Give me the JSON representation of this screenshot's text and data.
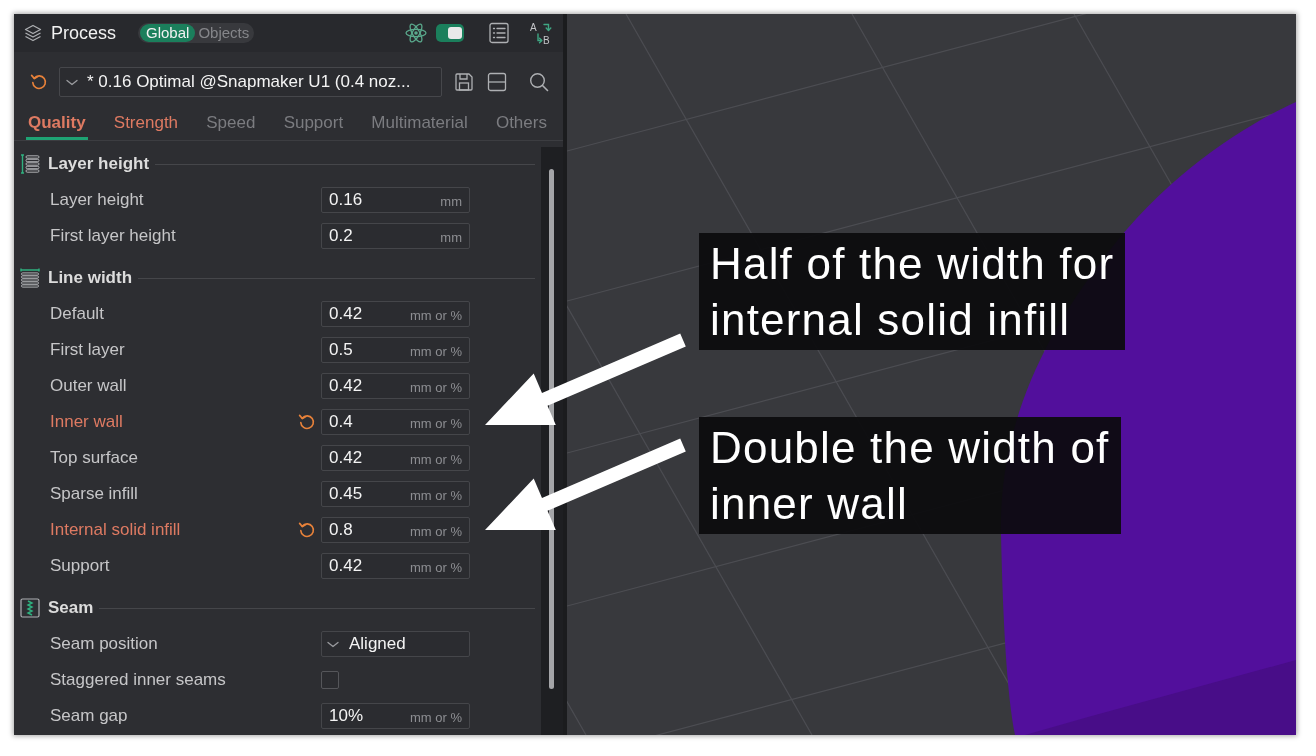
{
  "panel": {
    "title": "Process",
    "scope": [
      {
        "label": "Global",
        "selected": true
      },
      {
        "label": "Objects",
        "selected": false
      }
    ],
    "advanced_mode": {
      "on": true
    },
    "compare_icon": {
      "letters": [
        "A",
        "B"
      ]
    },
    "preset": {
      "name": "* 0.16 Optimal @Snapmaker U1 (0.4 noz...",
      "modified": true
    },
    "tabs": [
      {
        "label": "Quality",
        "selected": true,
        "modified": true
      },
      {
        "label": "Strength",
        "selected": false,
        "modified": true
      },
      {
        "label": "Speed",
        "selected": false,
        "modified": false
      },
      {
        "label": "Support",
        "selected": false,
        "modified": false
      },
      {
        "label": "Multimaterial",
        "selected": false,
        "modified": false
      },
      {
        "label": "Others",
        "selected": false,
        "modified": false
      }
    ],
    "sections": [
      {
        "title": "Layer height",
        "kind": "height",
        "items": [
          {
            "label": "Layer height",
            "kind": "number",
            "value": "0.16",
            "unit": "mm",
            "modified": false
          },
          {
            "label": "First layer height",
            "kind": "number",
            "value": "0.2",
            "unit": "mm",
            "modified": false
          }
        ]
      },
      {
        "title": "Line width",
        "kind": "width",
        "items": [
          {
            "label": "Default",
            "kind": "number",
            "value": "0.42",
            "unit": "mm or %",
            "modified": false
          },
          {
            "label": "First layer",
            "kind": "number",
            "value": "0.5",
            "unit": "mm or %",
            "modified": false
          },
          {
            "label": "Outer wall",
            "kind": "number",
            "value": "0.42",
            "unit": "mm or %",
            "modified": false
          },
          {
            "label": "Inner wall",
            "kind": "number",
            "value": "0.4",
            "unit": "mm or %",
            "modified": true
          },
          {
            "label": "Top surface",
            "kind": "number",
            "value": "0.42",
            "unit": "mm or %",
            "modified": false
          },
          {
            "label": "Sparse infill",
            "kind": "number",
            "value": "0.45",
            "unit": "mm or %",
            "modified": false
          },
          {
            "label": "Internal solid infill",
            "kind": "number",
            "value": "0.8",
            "unit": "mm or %",
            "modified": true
          },
          {
            "label": "Support",
            "kind": "number",
            "value": "0.42",
            "unit": "mm or %",
            "modified": false
          }
        ]
      },
      {
        "title": "Seam",
        "kind": "seam",
        "items": [
          {
            "label": "Seam position",
            "kind": "dropdown",
            "value": "Aligned",
            "modified": false
          },
          {
            "label": "Staggered inner seams",
            "kind": "checkbox",
            "checked": false,
            "modified": false
          },
          {
            "label": "Seam gap",
            "kind": "number",
            "value": "10%",
            "unit": "mm or %",
            "modified": false
          }
        ]
      }
    ]
  },
  "viewport": {
    "annotations": [
      {
        "lines": [
          "Half of the width for",
          "internal solid infill"
        ]
      },
      {
        "lines": [
          "Double the width of",
          "inner wall"
        ]
      }
    ]
  }
}
